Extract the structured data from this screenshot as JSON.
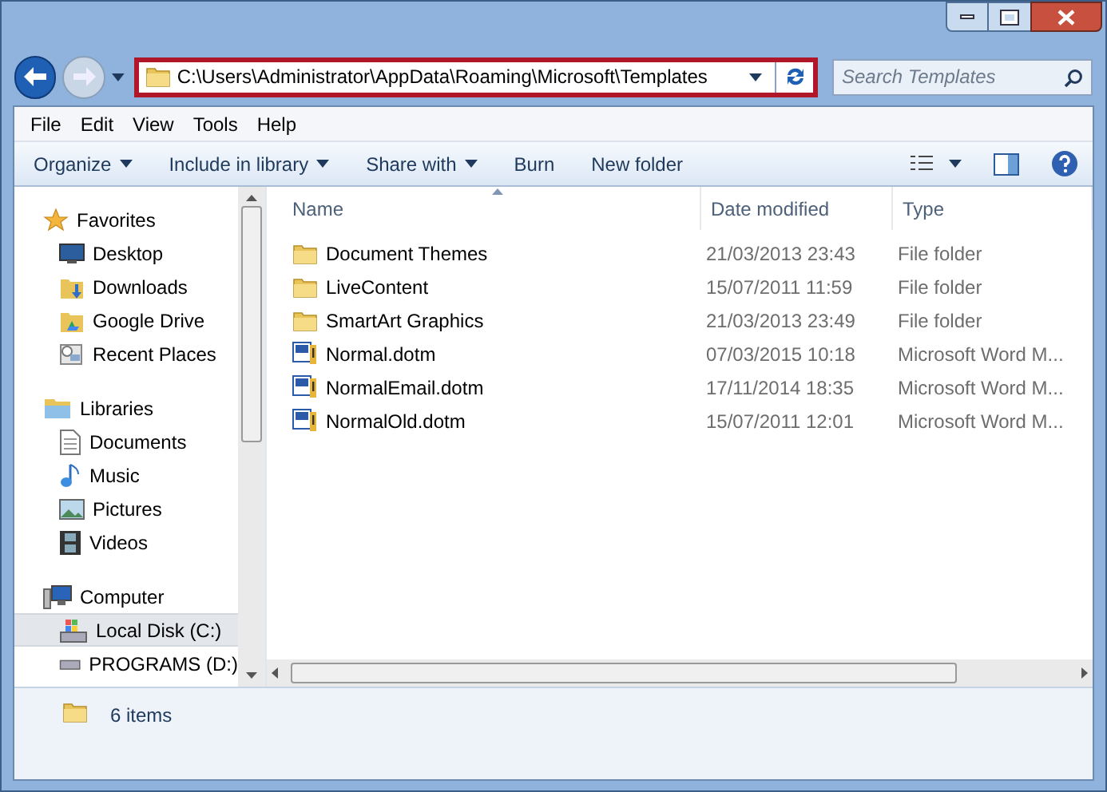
{
  "address_bar": {
    "path": "C:\\Users\\Administrator\\AppData\\Roaming\\Microsoft\\Templates",
    "highlighted": true
  },
  "search": {
    "placeholder": "Search Templates"
  },
  "menu": [
    "File",
    "Edit",
    "View",
    "Tools",
    "Help"
  ],
  "toolbar": [
    {
      "label": "Organize",
      "dropdown": true
    },
    {
      "label": "Include in library",
      "dropdown": true
    },
    {
      "label": "Share with",
      "dropdown": true
    },
    {
      "label": "Burn",
      "dropdown": false
    },
    {
      "label": "New folder",
      "dropdown": false
    }
  ],
  "navigation": [
    {
      "label": "Favorites",
      "children": [
        {
          "label": "Desktop",
          "selected": false
        },
        {
          "label": "Downloads",
          "selected": false
        },
        {
          "label": "Google Drive",
          "selected": false
        },
        {
          "label": "Recent Places",
          "selected": false
        }
      ]
    },
    {
      "label": "Libraries",
      "children": [
        {
          "label": "Documents",
          "selected": false
        },
        {
          "label": "Music",
          "selected": false
        },
        {
          "label": "Pictures",
          "selected": false
        },
        {
          "label": "Videos",
          "selected": false
        }
      ]
    },
    {
      "label": "Computer",
      "children": [
        {
          "label": "Local Disk (C:)",
          "selected": true
        },
        {
          "label": "PROGRAMS (D:)",
          "selected": false
        }
      ]
    }
  ],
  "columns": [
    {
      "label": "Name",
      "sorted": true
    },
    {
      "label": "Date modified",
      "sorted": false
    },
    {
      "label": "Type",
      "sorted": false
    }
  ],
  "files": [
    {
      "name": "Document Themes",
      "date": "21/03/2013 23:43",
      "type": "File folder",
      "kind": "folder"
    },
    {
      "name": "LiveContent",
      "date": "15/07/2011 11:59",
      "type": "File folder",
      "kind": "folder"
    },
    {
      "name": "SmartArt Graphics",
      "date": "21/03/2013 23:49",
      "type": "File folder",
      "kind": "folder"
    },
    {
      "name": "Normal.dotm",
      "date": "07/03/2015 10:18",
      "type": "Microsoft Word M...",
      "kind": "word"
    },
    {
      "name": "NormalEmail.dotm",
      "date": "17/11/2014 18:35",
      "type": "Microsoft Word M...",
      "kind": "word"
    },
    {
      "name": "NormalOld.dotm",
      "date": "15/07/2011 12:01",
      "type": "Microsoft Word M...",
      "kind": "word"
    }
  ],
  "status_bar": {
    "count": "6 items"
  }
}
